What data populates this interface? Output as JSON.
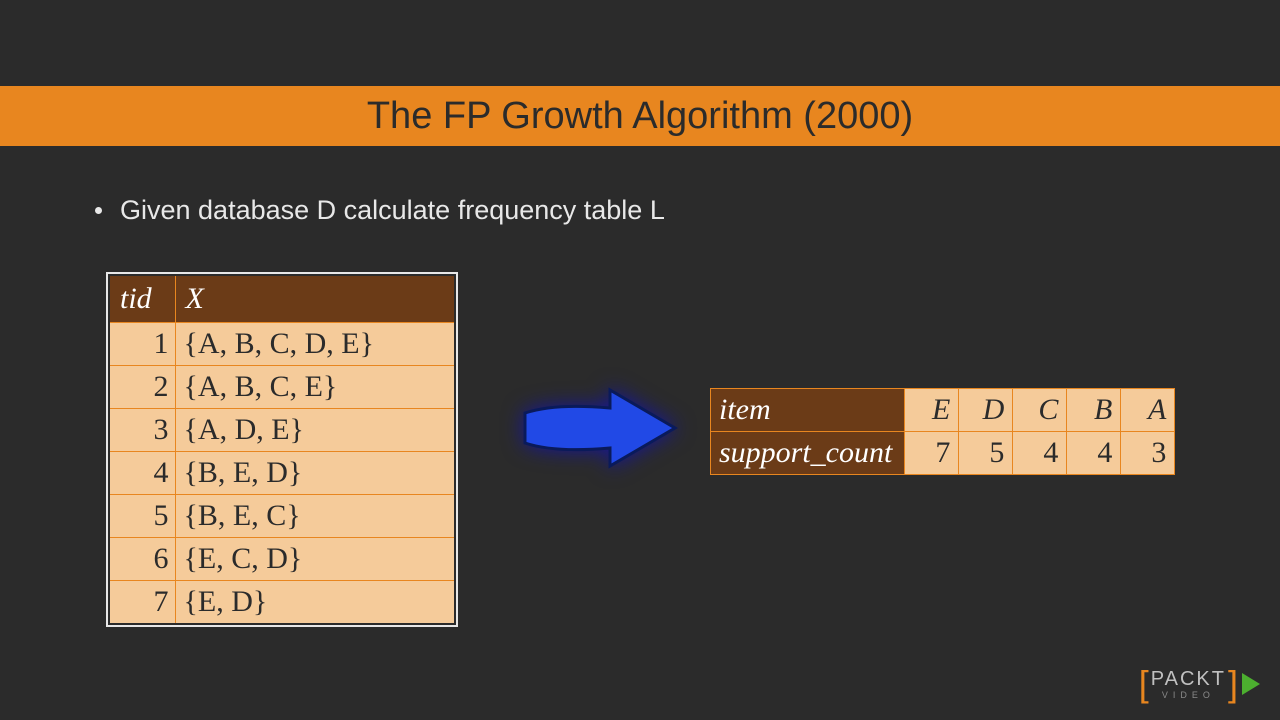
{
  "title": "The FP Growth Algorithm (2000)",
  "bullet": "Given database D calculate frequency table L",
  "db": {
    "head": {
      "tid": "tid",
      "x": "X"
    },
    "rows": [
      {
        "tid": "1",
        "x": "{A, B, C, D, E}"
      },
      {
        "tid": "2",
        "x": "{A, B, C, E}"
      },
      {
        "tid": "3",
        "x": "{A, D, E}"
      },
      {
        "tid": "4",
        "x": "{B, E, D}"
      },
      {
        "tid": "5",
        "x": "{B, E, C}"
      },
      {
        "tid": "6",
        "x": "{E, C, D}"
      },
      {
        "tid": "7",
        "x": "{E, D}"
      }
    ]
  },
  "freq": {
    "label_item": "item",
    "label_support": "support_count",
    "items": [
      "E",
      "D",
      "C",
      "B",
      "A"
    ],
    "counts": [
      "7",
      "5",
      "4",
      "4",
      "3"
    ]
  },
  "logo": {
    "brand": "PACKT",
    "sub": "VIDEO"
  },
  "chart_data": {
    "type": "table",
    "title": "The FP Growth Algorithm (2000) — frequency table L derived from database D",
    "database_D": {
      "columns": [
        "tid",
        "X"
      ],
      "rows": [
        [
          1,
          [
            "A",
            "B",
            "C",
            "D",
            "E"
          ]
        ],
        [
          2,
          [
            "A",
            "B",
            "C",
            "E"
          ]
        ],
        [
          3,
          [
            "A",
            "D",
            "E"
          ]
        ],
        [
          4,
          [
            "B",
            "E",
            "D"
          ]
        ],
        [
          5,
          [
            "B",
            "E",
            "C"
          ]
        ],
        [
          6,
          [
            "E",
            "C",
            "D"
          ]
        ],
        [
          7,
          [
            "E",
            "D"
          ]
        ]
      ]
    },
    "frequency_table_L": {
      "item": [
        "E",
        "D",
        "C",
        "B",
        "A"
      ],
      "support_count": [
        7,
        5,
        4,
        4,
        3
      ]
    }
  }
}
